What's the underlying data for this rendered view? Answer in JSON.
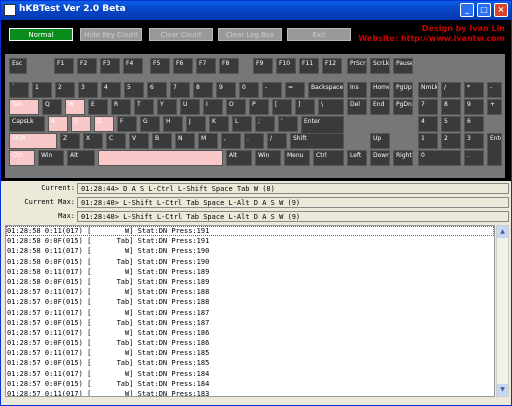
{
  "window": {
    "title": "hKBTest Ver 2.0 Beta",
    "min": "_",
    "max": "□",
    "close": "×"
  },
  "toolbar": {
    "normal": "Normal",
    "hide": "Hide Key Count",
    "clear_count": "Clear Count",
    "clear_log": "Clear Log Box",
    "exit": "Exit"
  },
  "credits": {
    "line1": "Design by Ivan Lin",
    "line2": "Website: http://www.ivantw.com"
  },
  "status": {
    "current_label": "Current:",
    "current": "01:28:44> D A S L-Ctrl L-Shift Space Tab W (8)",
    "current_max_label": "Current Max:",
    "current_max": "01:28:40> L-Shift L-Ctrl Tab Space L-Alt D A S W (9)",
    "max_label": "Max:",
    "max": "01:28:40> L-Shift L-Ctrl Tab Space L-Alt D A S W (9)"
  },
  "keys": [
    "Esc",
    "F1",
    "F2",
    "F3",
    "F4",
    "F5",
    "F6",
    "F7",
    "F8",
    "F9",
    "F10",
    "F11",
    "F12",
    "PrScr",
    "ScrLk",
    "Pause",
    "`",
    "1",
    "2",
    "3",
    "4",
    "5",
    "6",
    "7",
    "8",
    "9",
    "0",
    "-",
    "=",
    "Backspace",
    "Ins",
    "Home",
    "PgUp",
    "NmLk",
    "/",
    "*",
    "-",
    "Tab",
    "Q",
    "W",
    "E",
    "R",
    "T",
    "Y",
    "U",
    "I",
    "O",
    "P",
    "[",
    "]",
    "\\",
    "Del",
    "End",
    "PgDn",
    "7",
    "8",
    "9",
    "+",
    "CapsLk",
    "A",
    "S",
    "D",
    "F",
    "G",
    "H",
    "J",
    "K",
    "L",
    ";",
    "'",
    "Enter",
    "4",
    "5",
    "6",
    "Shift",
    "Z",
    "X",
    "C",
    "V",
    "B",
    "N",
    "M",
    ",",
    ".",
    "/",
    "Shift",
    "Up",
    "1",
    "2",
    "3",
    "Enter",
    "Ctrl",
    "Win",
    "Alt",
    "",
    "Alt",
    "Win",
    "Menu",
    "Ctrl",
    "Left",
    "Down",
    "Right",
    "0",
    "."
  ],
  "log": [
    "01:28:58 0:11(017) [        W] Stat:DN Press:191",
    "01:28:58 0:0F(015) [      Tab] Stat:DN Press:191",
    "01:28:58 0:11(017) [        W] Stat:DN Press:190",
    "01:28:58 0:0F(015) [      Tab] Stat:DN Press:190",
    "01:28:58 0:11(017) [        W] Stat:DN Press:189",
    "01:28:58 0:0F(015) [      Tab] Stat:DN Press:189",
    "01:28:57 0:11(017) [        W] Stat:DN Press:188",
    "01:28:57 0:0F(015) [      Tab] Stat:DN Press:188",
    "01:28:57 0:11(017) [        W] Stat:DN Press:187",
    "01:28:57 0:0F(015) [      Tab] Stat:DN Press:187",
    "01:28:57 0:11(017) [        W] Stat:DN Press:186",
    "01:28:57 0:0F(015) [      Tab] Stat:DN Press:186",
    "01:28:57 0:11(017) [        W] Stat:DN Press:185",
    "01:28:57 0:0F(015) [      Tab] Stat:DN Press:185",
    "01:28:57 0:11(017) [        W] Stat:DN Press:184",
    "01:28:57 0:0F(015) [      Tab] Stat:DN Press:184",
    "01:28:57 0:11(017) [        W] Stat:DN Press:183"
  ],
  "scroll": {
    "up": "▲",
    "down": "▼"
  }
}
